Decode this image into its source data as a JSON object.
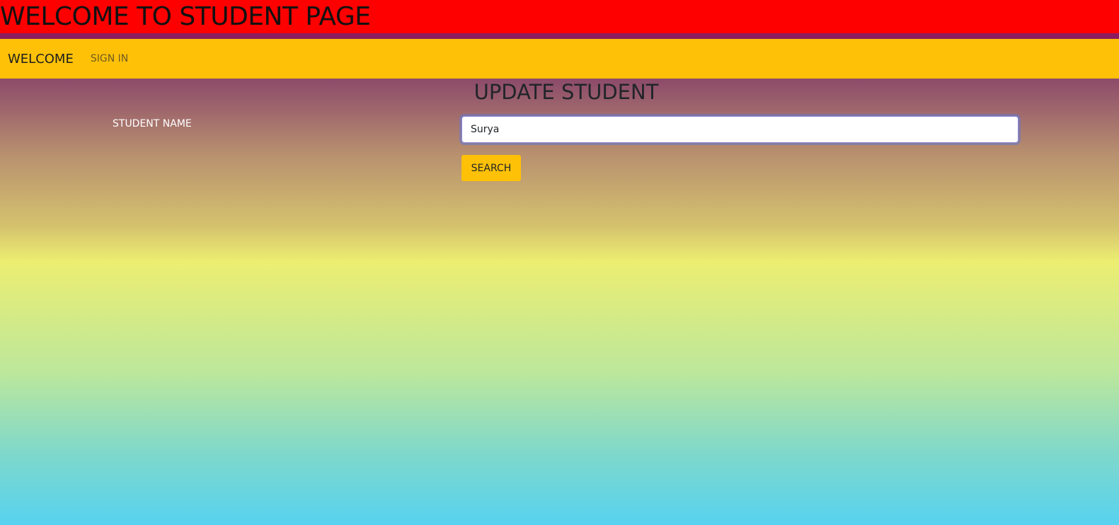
{
  "banner": {
    "title": "WELCOME TO STUDENT PAGE"
  },
  "navbar": {
    "brand": "WELCOME",
    "links": [
      {
        "label": "SIGN IN"
      }
    ]
  },
  "form": {
    "title": "UPDATE STUDENT",
    "student_name_label": "STUDENT NAME",
    "student_name_value": "Surya",
    "search_label": "SEARCH"
  },
  "colors": {
    "banner": "#ff0000",
    "divider": "#8c1c5e",
    "navbar": "#ffc107",
    "button": "#ffc107"
  }
}
